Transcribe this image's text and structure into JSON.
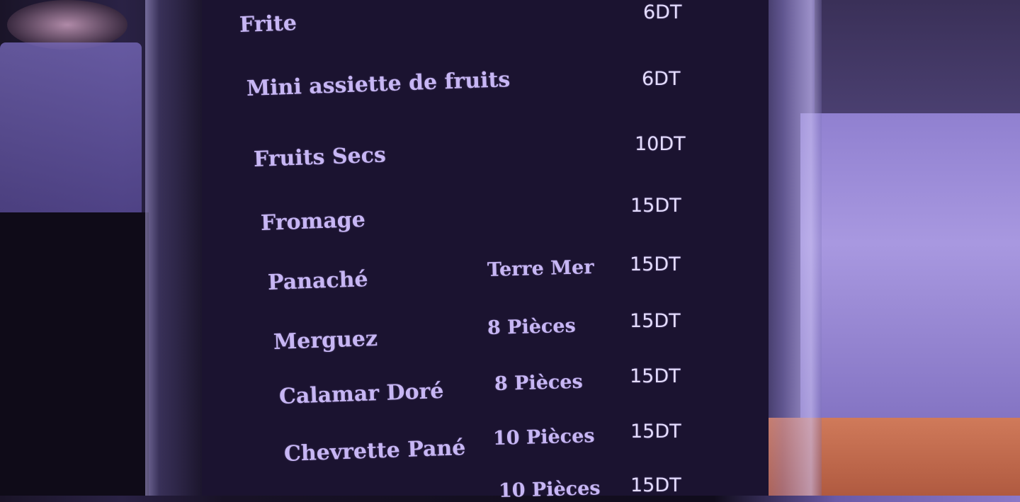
{
  "menu": {
    "items": [
      {
        "name": "Frite",
        "detail": "",
        "price": "6DT"
      },
      {
        "name": "Mini assiette de fruits",
        "detail": "",
        "price": "6DT"
      },
      {
        "name": "Fruits Secs",
        "detail": "",
        "price": "10DT"
      },
      {
        "name": "Fromage",
        "detail": "",
        "price": "15DT"
      },
      {
        "name": "Panaché",
        "detail": "Terre Mer",
        "price": "15DT"
      },
      {
        "name": "Merguez",
        "detail": "8 Pièces",
        "price": "15DT"
      },
      {
        "name": "Calamar Doré",
        "detail": "8 Pièces",
        "price": "15DT"
      },
      {
        "name": "Chevrette Pané",
        "detail": "10 Pièces",
        "price": "15DT"
      },
      {
        "name": "",
        "detail": "10 Pièces",
        "price": "15DT"
      }
    ]
  }
}
